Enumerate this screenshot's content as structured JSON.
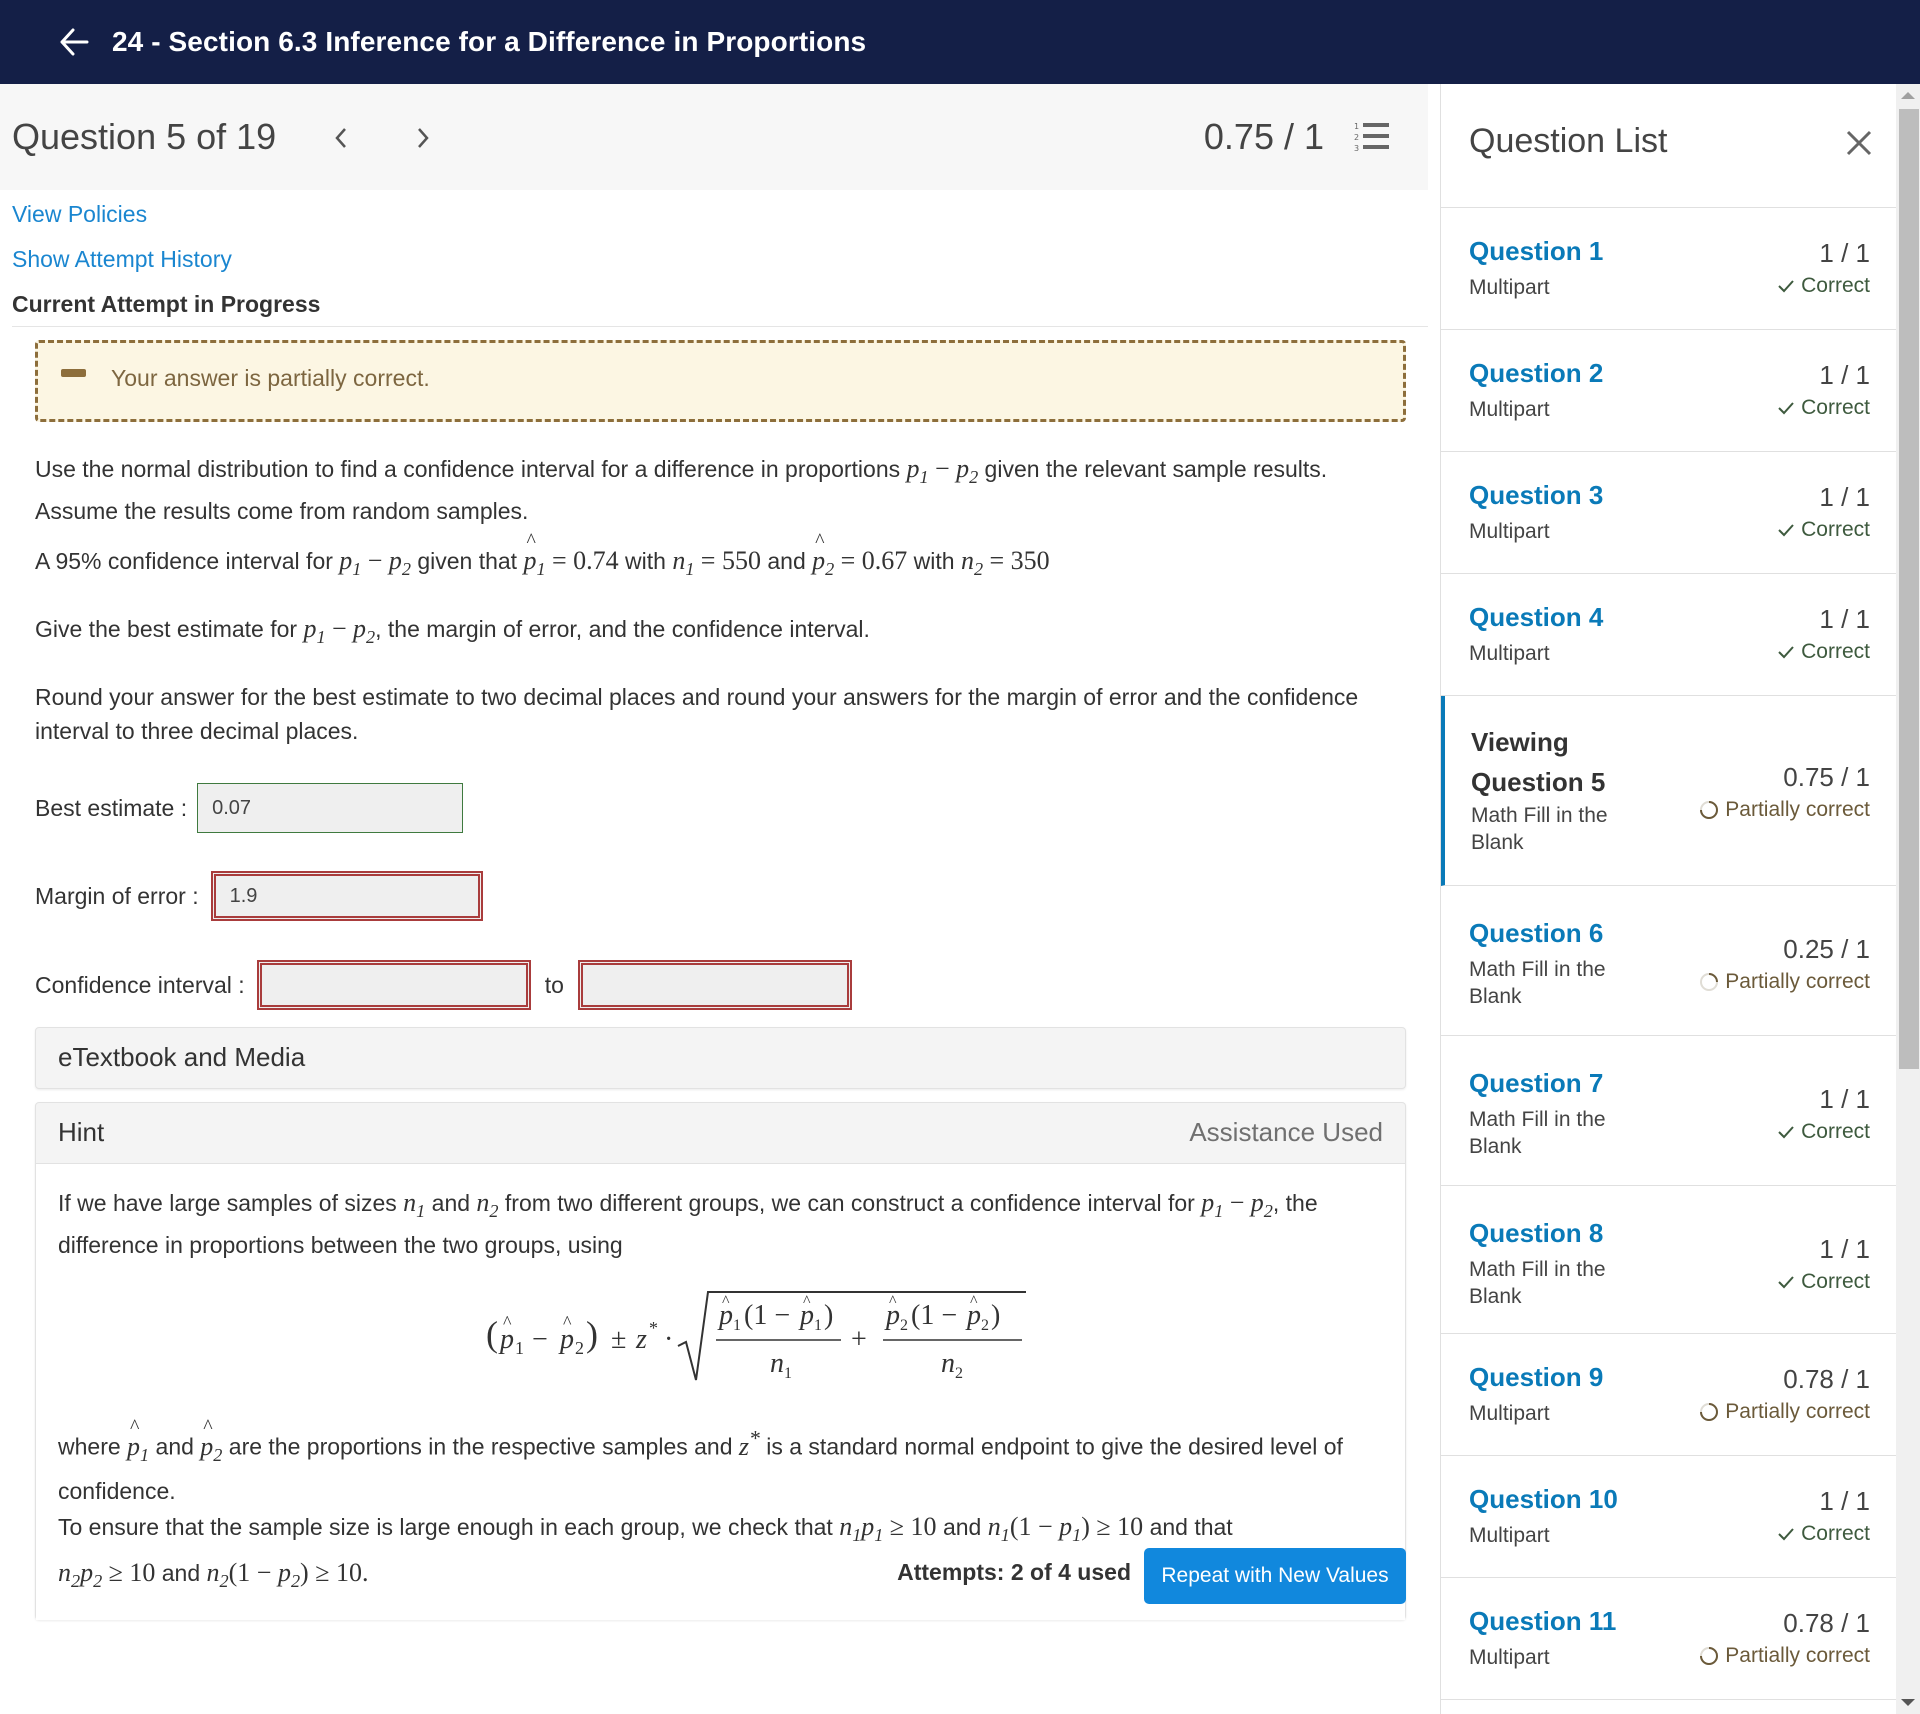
{
  "header": {
    "title": "24 - Section 6.3 Inference for a Difference in Proportions"
  },
  "question_header": {
    "label": "Question 5 of 19",
    "score": "0.75 / 1"
  },
  "links": {
    "view_policies": "View Policies",
    "attempt_history": "Show Attempt History",
    "current_attempt": "Current Attempt in Progress"
  },
  "feedback": {
    "message": "Your answer is partially correct."
  },
  "question": {
    "intro_1": "Use the normal distribution to find a confidence interval for a difference in proportions",
    "intro_2": "given the relevant sample results.",
    "intro_3": "Assume the results come from random samples.",
    "given_a": "A 95% confidence interval for",
    "given_b": "given that",
    "p1_value": "0.74",
    "with": "with",
    "n1_value": "550",
    "and": "and",
    "p2_value": "0.67",
    "n2_value": "350",
    "give_a": "Give the best estimate for",
    "give_b": ", the margin of error, and the confidence interval.",
    "round_1": "Round your answer for the best estimate to two decimal places and round your answers for the margin of error and the confidence",
    "round_2": "interval to three decimal places."
  },
  "answers": {
    "best_estimate_label": "Best estimate :",
    "best_estimate_value": "0.07",
    "best_estimate_status": "correct",
    "margin_label": "Margin of error :",
    "margin_value": "1.9",
    "margin_status": "incorrect",
    "ci_label": "Confidence interval :",
    "ci_lower": "",
    "ci_to": "to",
    "ci_upper": "",
    "ci_status": "incorrect"
  },
  "etextbook": {
    "label": "eTextbook and Media"
  },
  "hint": {
    "title": "Hint",
    "status": "Assistance Used",
    "p1_a": "If we have large samples of sizes",
    "p1_b": "and",
    "p1_c": "from two different groups, we can construct a confidence interval for",
    "p1_d": ", the",
    "p1_e": "difference in proportions between the two groups, using",
    "p2_a": "where",
    "p2_b": "and",
    "p2_c": "are the proportions in the respective samples and",
    "p2_d": "is a standard normal endpoint to give the desired level of",
    "p2_e": "confidence.",
    "p3_a": "To ensure that the sample size is large enough in each group, we check that",
    "p3_b": "and",
    "p3_c": "and that",
    "p3_d": "and"
  },
  "footer": {
    "attempts": "Attempts: 2 of 4 used",
    "repeat_button": "Repeat with New Values"
  },
  "sidebar": {
    "title": "Question List",
    "items": [
      {
        "name": "Question 1",
        "type": "Multipart",
        "score": "1 / 1",
        "status": "Correct",
        "state": "correct"
      },
      {
        "name": "Question 2",
        "type": "Multipart",
        "score": "1 / 1",
        "status": "Correct",
        "state": "correct"
      },
      {
        "name": "Question 3",
        "type": "Multipart",
        "score": "1 / 1",
        "status": "Correct",
        "state": "correct"
      },
      {
        "name": "Question 4",
        "type": "Multipart",
        "score": "1 / 1",
        "status": "Correct",
        "state": "correct"
      },
      {
        "prefix": "Viewing",
        "name": "Question 5",
        "type": "Math Fill in the Blank",
        "score": "0.75 / 1",
        "status": "Partially correct",
        "state": "partial",
        "active": true
      },
      {
        "name": "Question 6",
        "type": "Math Fill in the Blank",
        "score": "0.25 / 1",
        "status": "Partially correct",
        "state": "partial"
      },
      {
        "name": "Question 7",
        "type": "Math Fill in the Blank",
        "score": "1 / 1",
        "status": "Correct",
        "state": "correct"
      },
      {
        "name": "Question 8",
        "type": "Math Fill in the Blank",
        "score": "1 / 1",
        "status": "Correct",
        "state": "correct"
      },
      {
        "name": "Question 9",
        "type": "Multipart",
        "score": "0.78 / 1",
        "status": "Partially correct",
        "state": "partial"
      },
      {
        "name": "Question 10",
        "type": "Multipart",
        "score": "1 / 1",
        "status": "Correct",
        "state": "correct"
      },
      {
        "name": "Question 11",
        "type": "Multipart",
        "score": "0.78 / 1",
        "status": "Partially correct",
        "state": "partial"
      }
    ]
  },
  "colors": {
    "nav": "#141f47",
    "link": "#1a86d0",
    "accent": "#0a7ab8",
    "button": "#1188dd",
    "correct_border": "#3f7a3f",
    "incorrect_border": "#a93c3c",
    "feedback_bg": "#fcf6e3"
  }
}
